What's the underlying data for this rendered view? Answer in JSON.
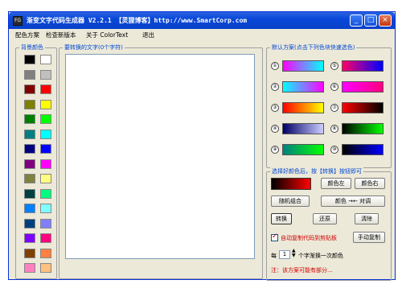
{
  "titlebar": {
    "icon_text": "FG",
    "title": "渐变文字代码生成器 V2.2.1 【灵狸博客】http://www.SmartCorp.com",
    "min_label": "_",
    "max_label": "□",
    "close_label": "×"
  },
  "menu": [
    "配色方案",
    "检查新版本",
    "关于 ColorText",
    "退出"
  ],
  "bg_colors": {
    "title": "背景颜色",
    "swatches": [
      "#000000",
      "#ffffff",
      "#808080",
      "#c0c0c0",
      "#800000",
      "#ff0000",
      "#808000",
      "#ffff00",
      "#008000",
      "#00ff00",
      "#008080",
      "#00ffff",
      "#000080",
      "#0000ff",
      "#800080",
      "#ff00ff",
      "#808040",
      "#ffff80",
      "#004040",
      "#00ff80",
      "#0080ff",
      "#80ffff",
      "#004080",
      "#8080ff",
      "#8000ff",
      "#ff0080",
      "#804000",
      "#ff8040",
      "#ff80c0",
      "#ffc080"
    ]
  },
  "text_area": {
    "title": "要转换的文字(0个字符)",
    "value": ""
  },
  "default_schemes": {
    "title": "默认方案(点击下列色块快速选色)",
    "items": [
      {
        "num": "①",
        "from": "#ff00ff",
        "to": "#00ffff"
      },
      {
        "num": "⑤",
        "from": "#ff0066",
        "to": "#0000ff"
      },
      {
        "num": "②",
        "from": "#00ffff",
        "to": "#ff00ff"
      },
      {
        "num": "⑥",
        "from": "#ff00ff",
        "to": "#ff0080"
      },
      {
        "num": "③",
        "from": "#ff0000",
        "to": "#ffff00"
      },
      {
        "num": "⑦",
        "from": "#ff0000",
        "to": "#000000"
      },
      {
        "num": "④",
        "from": "#000066",
        "to": "#ccccff"
      },
      {
        "num": "⑧",
        "from": "#000000",
        "to": "#00ff00"
      },
      {
        "num": "⑨",
        "from": "#008080",
        "to": "#00ff00"
      },
      {
        "num": "⑩",
        "from": "#000000",
        "to": "#0000ff"
      }
    ]
  },
  "custom": {
    "title": "选择好颜色后，按【转换】按钮即可",
    "preview_from": "#000000",
    "preview_to": "#ff0000",
    "color_left": "颜色左",
    "color_right": "颜色右",
    "random": "随机组合",
    "swap": "颜色 →← 对调",
    "convert": "转换",
    "restore": "还原",
    "clear": "清除",
    "auto_copy": "自动复制代码到剪贴板",
    "manual_copy": "手动复制",
    "every_prefix": "每",
    "every_value": "1",
    "every_suffix": "个字渐换一次颜色",
    "note": "注：该方案可能有部分..."
  }
}
